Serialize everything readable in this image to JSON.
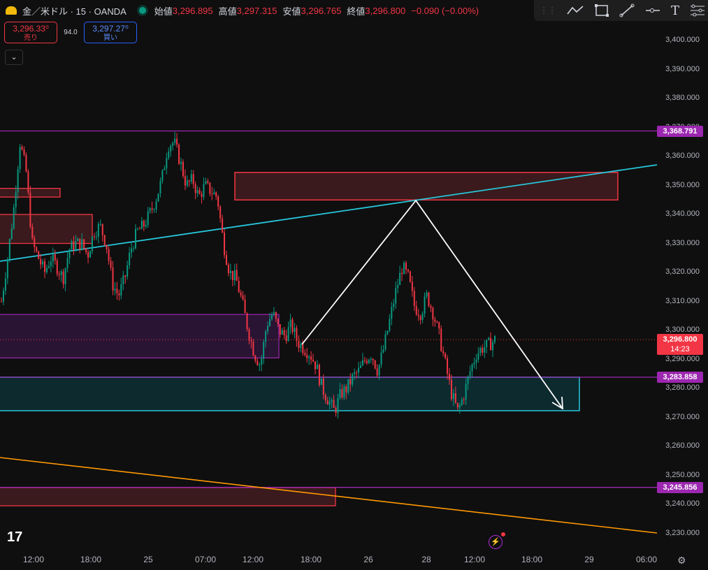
{
  "header": {
    "symbol": "金／米ドル · 15 · OANDA",
    "open_label": "始値",
    "open": "3,296.895",
    "high_label": "高値",
    "high": "3,297.315",
    "low_label": "安値",
    "low": "3,296.765",
    "close_label": "終値",
    "close": "3,296.800",
    "change": "−0.090 (−0.00%)"
  },
  "trade": {
    "sell_price": "3,296.33⁰",
    "sell_label": "売り",
    "spread": "94.0",
    "buy_price": "3,297.27⁰",
    "buy_label": "買い"
  },
  "collapse_label": "⌄",
  "toolbar": {
    "icons": [
      "trend-line-icon",
      "rectangle-icon",
      "line-tool-icon",
      "horizontal-ray-icon",
      "text-icon",
      "settings-icon"
    ],
    "text_glyph": "T"
  },
  "y_axis": {
    "ticks": [
      "3,400.000",
      "3,390.000",
      "3,380.000",
      "3,370.000",
      "3,360.000",
      "3,350.000",
      "3,340.000",
      "3,330.000",
      "3,320.000",
      "3,310.000",
      "3,300.000",
      "3,290.000",
      "3,280.000",
      "3,270.000",
      "3,260.000",
      "3,250.000",
      "3,240.000",
      "3,230.000"
    ],
    "tick_values": [
      3400,
      3390,
      3380,
      3370,
      3360,
      3350,
      3340,
      3330,
      3320,
      3310,
      3300,
      3290,
      3280,
      3270,
      3260,
      3250,
      3240,
      3230
    ]
  },
  "price_tags": {
    "level_1": "3,368.791",
    "level_2": "3,283.858",
    "level_3": "3,245.856",
    "current_price": "3,296.800",
    "countdown": "14:23"
  },
  "x_axis": [
    "12:00",
    "18:00",
    "25",
    "07:00",
    "12:00",
    "18:00",
    "26",
    "28",
    "12:00",
    "18:00",
    "29",
    "06:00"
  ],
  "colors": {
    "background": "#0f0f0f",
    "up": "#089981",
    "down": "#f23645",
    "purple": "#9c27b0",
    "cyan": "#26c6da",
    "orange": "#ff9800",
    "white": "#ffffff"
  },
  "chart_data": {
    "type": "candlestick",
    "ylim": [
      3225,
      3405
    ],
    "price_levels": [
      3368.791,
      3283.858,
      3245.856
    ],
    "current_price": 3296.8,
    "close_path": [
      [
        3310,
        3325,
        3342,
        3365,
        3355,
        3330,
        3325,
        3320,
        3325,
        3322,
        3318,
        3328,
        3330,
        3330,
        3326,
        3334,
        3336,
        3330,
        3316,
        3312,
        3318,
        3328,
        3334,
        3336,
        3340,
        3345,
        3352,
        3364,
        3365,
        3358,
        3350,
        3352,
        3346,
        3350,
        3348,
        3346,
        3330,
        3320,
        3318,
        3310,
        3300,
        3292,
        3288,
        3302,
        3306,
        3300,
        3298,
        3302,
        3296,
        3294,
        3292,
        3288,
        3280,
        3276,
        3272,
        3278,
        3280,
        3284,
        3286,
        3290,
        3292,
        3286,
        3294,
        3304,
        3314,
        3322,
        3318,
        3308,
        3306,
        3312,
        3306,
        3298,
        3288,
        3278,
        3272,
        3278,
        3286,
        3292,
        3294,
        3295,
        3296.8
      ]
    ]
  }
}
